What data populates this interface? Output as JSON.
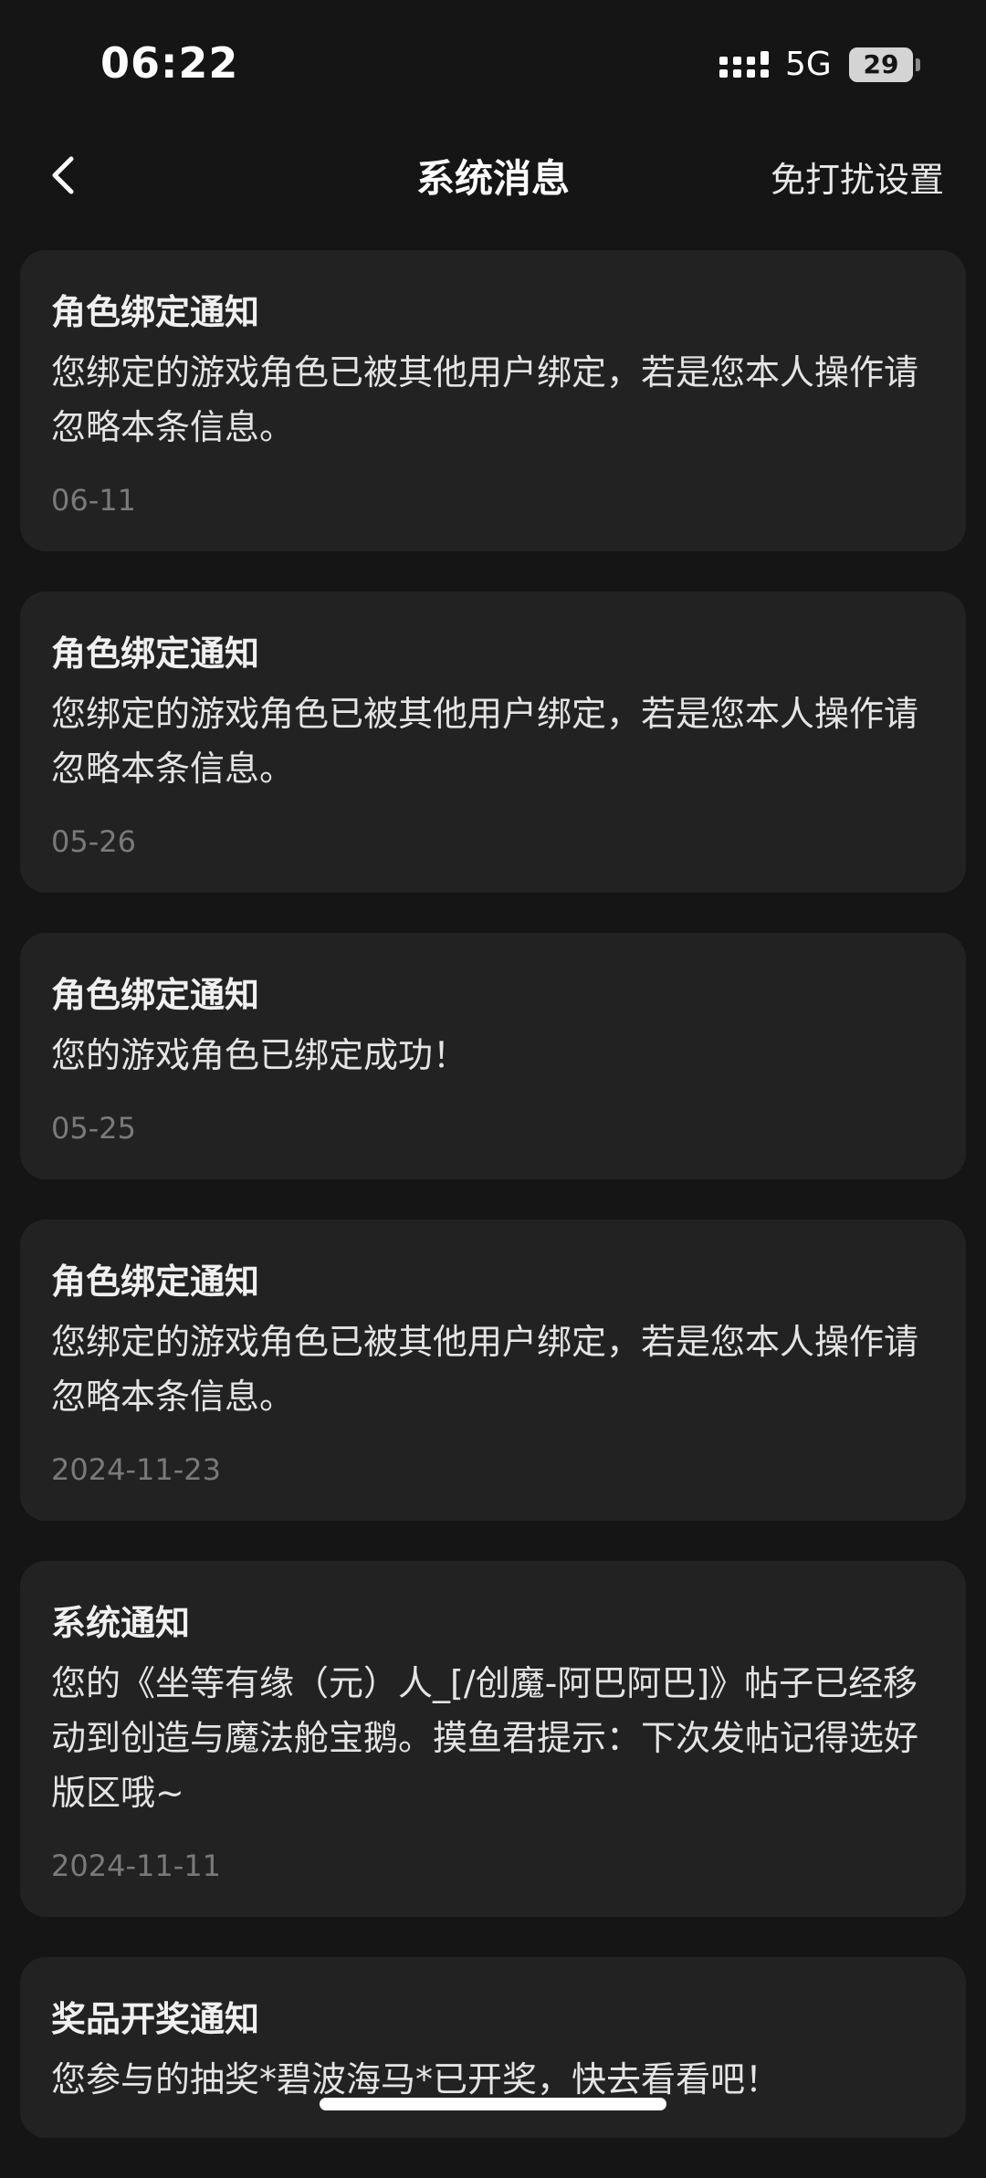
{
  "status_bar": {
    "time": "06:22",
    "network": "5G",
    "battery": "29"
  },
  "nav": {
    "title": "系统消息",
    "dnd_label": "免打扰设置"
  },
  "messages": [
    {
      "title": "角色绑定通知",
      "body": "您绑定的游戏角色已被其他用户绑定，若是您本人操作请忽略本条信息。",
      "date": "06-11"
    },
    {
      "title": "角色绑定通知",
      "body": "您绑定的游戏角色已被其他用户绑定，若是您本人操作请忽略本条信息。",
      "date": "05-26"
    },
    {
      "title": "角色绑定通知",
      "body": "您的游戏角色已绑定成功！",
      "date": "05-25"
    },
    {
      "title": "角色绑定通知",
      "body": "您绑定的游戏角色已被其他用户绑定，若是您本人操作请忽略本条信息。",
      "date": "2024-11-23"
    },
    {
      "title": "系统通知",
      "body": "您的《坐等有缘（元）人_[/创魔-阿巴阿巴]》帖子已经移动到创造与魔法舱宝鹅。摸鱼君提示：下次发帖记得选好版区哦~",
      "date": "2024-11-11"
    },
    {
      "title": "奖品开奖通知",
      "body": "您参与的抽奖*碧波海马*已开奖，快去看看吧！",
      "date": ""
    }
  ]
}
